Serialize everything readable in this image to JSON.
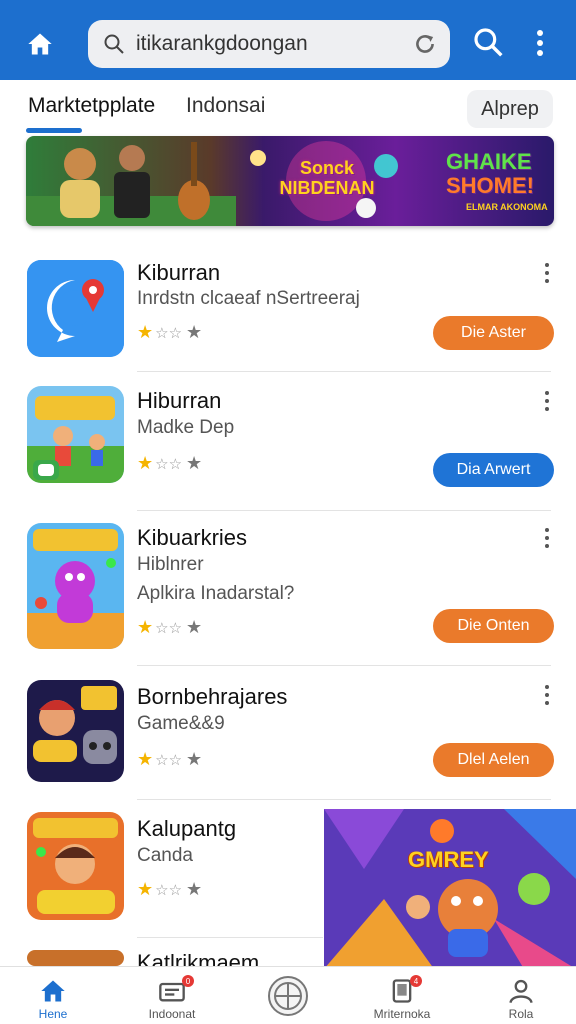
{
  "colors": {
    "brand": "#1d6fce",
    "orange_action": "#ea7a2b",
    "blue_action": "#1f74d6",
    "star": "#f5b400"
  },
  "header": {
    "home_icon": "home-icon",
    "search": {
      "value": "itikarankgdoongan",
      "icon": "search-icon",
      "refresh_icon": "refresh-icon"
    },
    "search_button_icon": "search-icon",
    "more_icon": "more-vertical-icon"
  },
  "tabs": [
    {
      "label": "Marktetpplate",
      "active": true
    },
    {
      "label": "Indonsai",
      "active": false
    }
  ],
  "tab_chip": {
    "label": "Alprep"
  },
  "banner": {
    "title_line1": "Sonck",
    "title_line2": "NIBDENAN",
    "brand_line1": "GHAIKE",
    "brand_line2": "SHOME!",
    "brand_sub": "ELMAR AKONOMA"
  },
  "apps": [
    {
      "name": "Kiburran",
      "sub1": "Inrdstn clcaeaf nSertreeraj",
      "sub2": "",
      "rating": 1,
      "action": "Die Aster",
      "action_color": "orange",
      "icon": "chat-pin-icon"
    },
    {
      "name": "Hiburran",
      "sub1": "Madke Dep",
      "sub2": "",
      "rating": 1,
      "action": "Dia Arwert",
      "action_color": "blue",
      "icon": "kids-game-icon"
    },
    {
      "name": "Kibuarkries",
      "sub1": "Hiblnrer",
      "sub2": "Aplkira Inadarstal?",
      "rating": 1,
      "action": "Die Onten",
      "action_color": "orange",
      "icon": "monster-game-icon"
    },
    {
      "name": "Bornbehrajares",
      "sub1": "Game&&9",
      "sub2": "",
      "rating": 1,
      "action": "Dlel Aelen",
      "action_color": "orange",
      "icon": "gamer-icon"
    },
    {
      "name": "Kalupantg",
      "sub1": "Canda",
      "sub2": "",
      "rating": 1,
      "action": "",
      "action_color": "",
      "icon": "cartoon-game-icon"
    },
    {
      "name": "Katlrikmaem",
      "sub1": "",
      "sub2": "",
      "rating": 0,
      "action": "",
      "action_color": "",
      "icon": "game-icon"
    }
  ],
  "promo": {
    "title": "GMREY"
  },
  "bottom_nav": [
    {
      "label": "Hene",
      "icon": "home-icon",
      "active": true,
      "badge": ""
    },
    {
      "label": "Indoonat",
      "icon": "inbox-icon",
      "active": false,
      "badge": "0"
    },
    {
      "label": "",
      "icon": "globe-icon",
      "active": false,
      "badge": ""
    },
    {
      "label": "Mriternoka",
      "icon": "device-icon",
      "active": false,
      "badge": "4"
    },
    {
      "label": "Rola",
      "icon": "profile-icon",
      "active": false,
      "badge": ""
    }
  ]
}
